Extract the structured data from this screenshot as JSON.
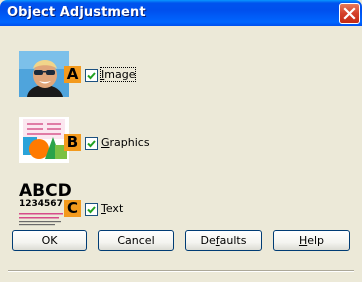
{
  "window": {
    "title": "Object Adjustment"
  },
  "options": [
    {
      "marker": "A",
      "label": "Image",
      "mnemonic": "I",
      "rest": "mage",
      "checked": true
    },
    {
      "marker": "B",
      "label": "Graphics",
      "mnemonic": "G",
      "rest": "raphics",
      "checked": true
    },
    {
      "marker": "C",
      "label": "Text",
      "mnemonic": "T",
      "rest": "ext",
      "checked": true
    }
  ],
  "text_sample": {
    "line1": "ABCD",
    "line2": "1234567"
  },
  "buttons": {
    "ok": "OK",
    "cancel": "Cancel",
    "defaults": {
      "before": "De",
      "mnemonic": "f",
      "after": "aults"
    },
    "help": {
      "mnemonic": "H",
      "after": "elp"
    }
  },
  "colors": {
    "title_bar": "#0054e3",
    "marker": "#f39a1d",
    "dialog_bg": "#ece9d8",
    "close": "#d4402a"
  }
}
